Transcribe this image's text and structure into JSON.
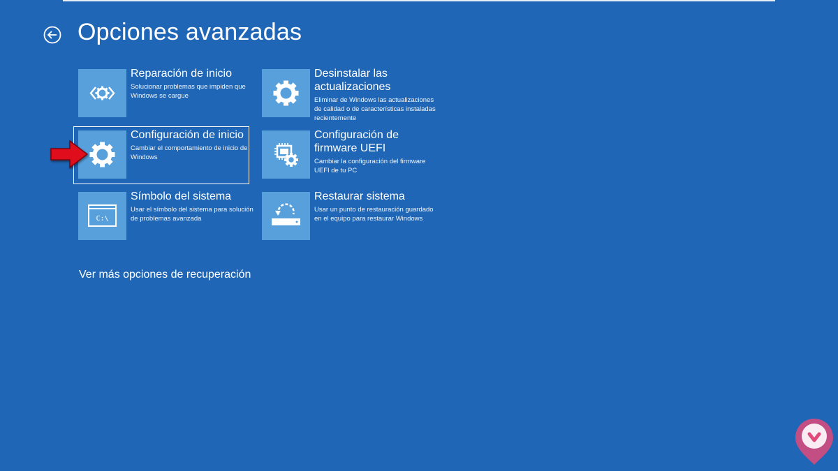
{
  "header": {
    "title": "Opciones avanzadas",
    "back_icon": "back-arrow-icon"
  },
  "options": [
    {
      "title": "Reparación de inicio",
      "desc": "Solucionar problemas que impiden que Windows se cargue",
      "icon": "repair-code-icon"
    },
    {
      "title": "Desinstalar las actualizaciones",
      "desc": "Eliminar de Windows las actualizaciones de calidad o de características instaladas recientemente",
      "icon": "gear-icon"
    },
    {
      "title": "Configuración de inicio",
      "desc": "Cambiar el comportamiento de inicio de Windows",
      "icon": "gear-icon",
      "selected": true
    },
    {
      "title": "Configuración de firmware UEFI",
      "desc": "Cambiar la configuración del firmware UEFI de tu PC",
      "icon": "chip-gear-icon"
    },
    {
      "title": "Símbolo del sistema",
      "desc": "Usar el símbolo del sistema para solución de problemas avanzada",
      "icon": "command-prompt-icon",
      "icon_text": "C:\\"
    },
    {
      "title": "Restaurar sistema",
      "desc": "Usar un punto de restauración guardado en el equipo para restaurar Windows",
      "icon": "restore-icon"
    }
  ],
  "footer": {
    "more_options": "Ver más opciones de recuperación"
  },
  "colors": {
    "background": "#1f66b6",
    "tile": "#57a0dc",
    "arrow": "#e0101a"
  }
}
